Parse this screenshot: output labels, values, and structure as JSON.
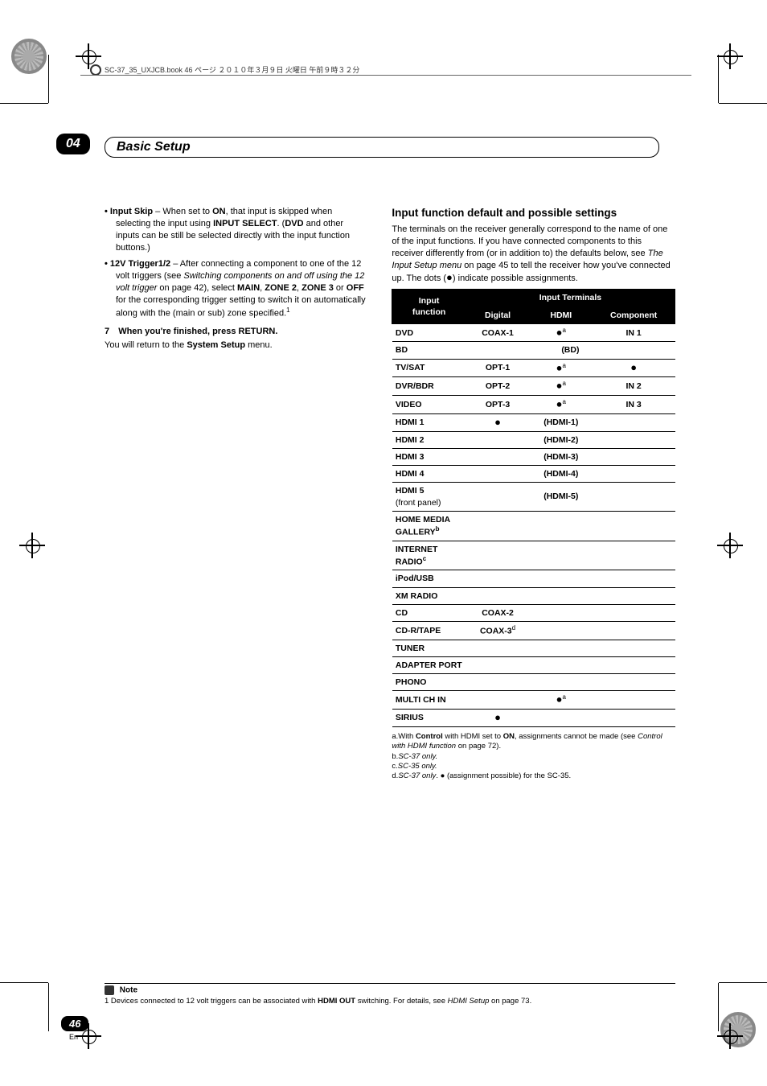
{
  "running_head": "SC-37_35_UXJCB.book  46 ページ  ２０１０年３月９日  火曜日  午前９時３２分",
  "chapter_num": "04",
  "section_title": "Basic Setup",
  "left": {
    "bullets": [
      {
        "lead": "Input Skip",
        "rest": " – When set to ",
        "bold1": "ON",
        "rest2": ", that input is skipped when selecting the input using ",
        "bold2": "INPUT SELECT",
        "rest3": ". (",
        "bold3": "DVD",
        "rest4": " and other inputs can be still be selected directly with the input function buttons.)"
      },
      {
        "lead": "12V Trigger1/2",
        "rest": " – After connecting a component to one of the 12 volt triggers (see ",
        "ital": "Switching components on and off using the 12 volt trigger",
        "rest2": " on page 42), select ",
        "bold1": "MAIN",
        "sep1": ", ",
        "bold2": "ZONE 2",
        "sep2": ", ",
        "bold3": "ZONE 3",
        "sep3": " or ",
        "bold4": "OFF",
        "rest3": " for the corresponding trigger setting to switch it on automatically along with the (main or sub) zone specified.",
        "sup": "1"
      }
    ],
    "step_num": "7",
    "step_bold": "When you're finished, press RETURN.",
    "step_tail_a": "You will return to the ",
    "step_tail_bold": "System Setup",
    "step_tail_b": " menu."
  },
  "right": {
    "heading": "Input function default and possible settings",
    "intro_a": "The terminals on the receiver generally correspond to the name of one of the input functions. If you have connected components to this receiver differently from (or in addition to) the defaults below, see ",
    "intro_ital": "The Input Setup menu",
    "intro_b": " on page 45 to tell the receiver how you've connected up. The dots (",
    "intro_dot": "●",
    "intro_c": ") indicate possible assignments.",
    "th_input_a": "Input",
    "th_input_b": "function",
    "th_terminals": "Input Terminals",
    "th_digital": "Digital",
    "th_hdmi": "HDMI",
    "th_component": "Component",
    "rows": [
      {
        "f": "DVD",
        "d": "COAX-1",
        "h": "●",
        "ha": "a",
        "c": "IN 1"
      },
      {
        "f": "BD",
        "span": "(BD)"
      },
      {
        "f": "TV/SAT",
        "d": "OPT-1",
        "h": "●",
        "ha": "a",
        "c": "●"
      },
      {
        "f": "DVR/BDR",
        "d": "OPT-2",
        "h": "●",
        "ha": "a",
        "c": "IN 2"
      },
      {
        "f": "VIDEO",
        "d": "OPT-3",
        "h": "●",
        "ha": "a",
        "c": "IN 3"
      },
      {
        "f": "HDMI 1",
        "d": "●",
        "h": "(HDMI-1)",
        "c": ""
      },
      {
        "f": "HDMI 2",
        "d": "",
        "h": "(HDMI-2)",
        "c": ""
      },
      {
        "f": "HDMI 3",
        "d": "",
        "h": "(HDMI-3)",
        "c": ""
      },
      {
        "f": "HDMI 4",
        "d": "",
        "h": "(HDMI-4)",
        "c": ""
      },
      {
        "f": "HDMI 5",
        "sub": "(front panel)",
        "d": "",
        "h": "(HDMI-5)",
        "c": ""
      },
      {
        "f": "HOME MEDIA GALLERY",
        "fsup": "b",
        "d": "",
        "h": "",
        "c": ""
      },
      {
        "f": "INTERNET RADIO",
        "fsup": "c",
        "d": "",
        "h": "",
        "c": ""
      },
      {
        "f": "iPod/USB",
        "d": "",
        "h": "",
        "c": ""
      },
      {
        "f": "XM RADIO",
        "d": "",
        "h": "",
        "c": ""
      },
      {
        "f": "CD",
        "d": "COAX-2",
        "h": "",
        "c": ""
      },
      {
        "f": "CD-R/TAPE",
        "d": "COAX-3",
        "dsup": "d",
        "h": "",
        "c": ""
      },
      {
        "f": "TUNER",
        "d": "",
        "h": "",
        "c": ""
      },
      {
        "f": "ADAPTER PORT",
        "d": "",
        "h": "",
        "c": ""
      },
      {
        "f": "PHONO",
        "d": "",
        "h": "",
        "c": ""
      },
      {
        "f": "MULTI CH IN",
        "d": "",
        "h": "●",
        "ha": "a",
        "c": ""
      },
      {
        "f": "SIRIUS",
        "d": "●",
        "h": "",
        "c": ""
      }
    ],
    "note_a_pre": "a.With ",
    "note_a_b1": "Control",
    "note_a_mid": " with HDMI set to ",
    "note_a_b2": "ON",
    "note_a_post": ", assignments cannot be made (see ",
    "note_a_ital": "Control with HDMI function",
    "note_a_end": " on page 72).",
    "note_b": "b.",
    "note_b_ital": "SC-37 only.",
    "note_c": "c.",
    "note_c_ital": "SC-35 only.",
    "note_d": "d.",
    "note_d_ital": "SC-37 only",
    "note_d_rest": ". ● (assignment possible) for the SC-35."
  },
  "footnote": {
    "label": "Note",
    "text_a": "1 Devices connected to 12 volt triggers can be associated with ",
    "text_bold": "HDMI OUT",
    "text_b": " switching. For details, see ",
    "text_ital": "HDMI Setup",
    "text_c": " on page 73."
  },
  "page_number": "46",
  "page_lang": "En"
}
